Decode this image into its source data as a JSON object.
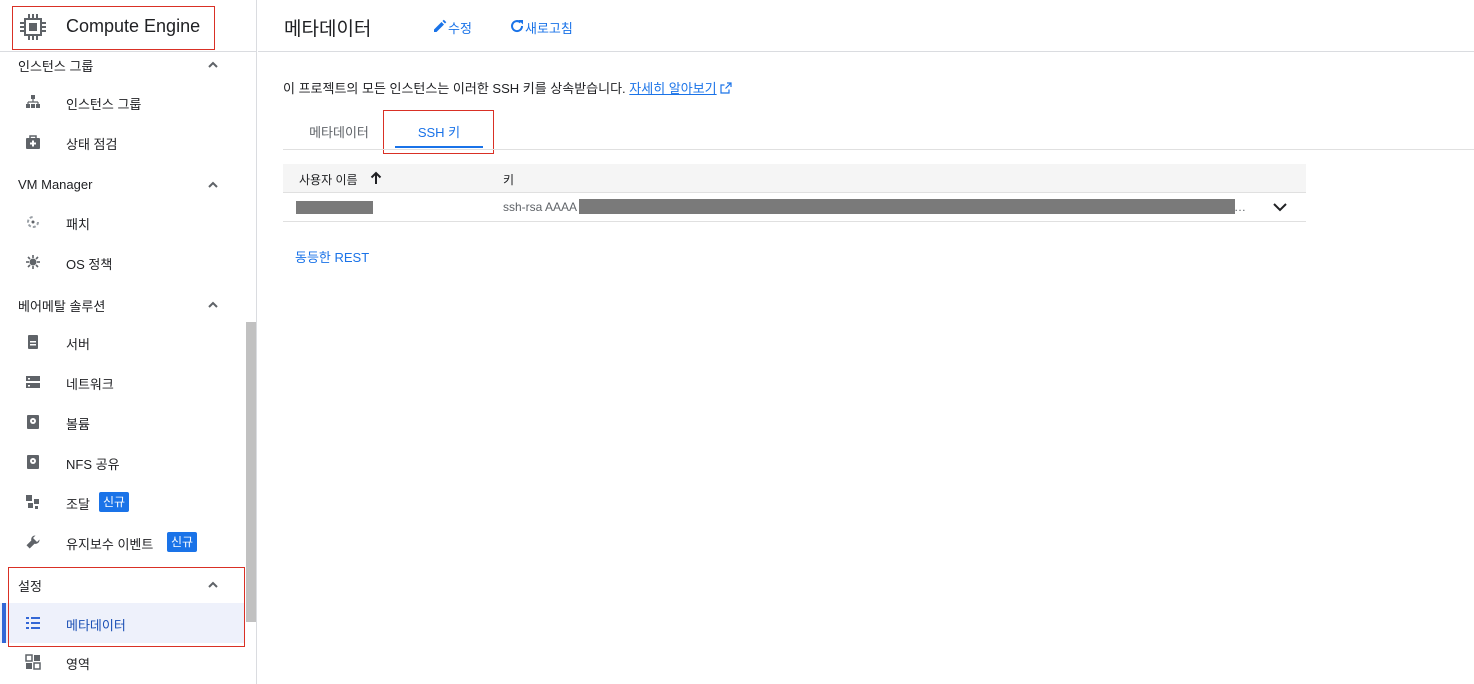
{
  "app": {
    "title": "Compute Engine"
  },
  "sidebar": {
    "sections": [
      {
        "label": "인스턴스 그룹"
      },
      {
        "label": "VM Manager"
      },
      {
        "label": "베어메탈 솔루션"
      },
      {
        "label": "설정"
      }
    ],
    "items": [
      {
        "label": "인스턴스 그룹",
        "icon": "instance-groups-icon"
      },
      {
        "label": "상태 점검",
        "icon": "health-check-icon"
      },
      {
        "label": "패치",
        "icon": "patch-icon"
      },
      {
        "label": "OS 정책",
        "icon": "os-policy-icon"
      },
      {
        "label": "서버",
        "icon": "server-icon"
      },
      {
        "label": "네트워크",
        "icon": "network-icon"
      },
      {
        "label": "볼륨",
        "icon": "volume-icon"
      },
      {
        "label": "NFS 공유",
        "icon": "nfs-share-icon"
      },
      {
        "label": "조달",
        "icon": "procurement-icon",
        "badge": "신규"
      },
      {
        "label": "유지보수 이벤트",
        "icon": "wrench-icon",
        "badge": "신규"
      },
      {
        "label": "메타데이터",
        "icon": "metadata-icon",
        "active": true
      },
      {
        "label": "영역",
        "icon": "zones-icon"
      }
    ]
  },
  "header": {
    "title": "메타데이터",
    "edit_label": "수정",
    "refresh_label": "새로고침"
  },
  "main": {
    "info_text": "이 프로젝트의 모든 인스턴스는 이러한 SSH 키를 상속받습니다.",
    "learn_more": "자세히 알아보기",
    "tabs": [
      {
        "label": "메타데이터"
      },
      {
        "label": "SSH 키",
        "active": true
      }
    ],
    "table": {
      "columns": [
        "사용자 이름",
        "키"
      ],
      "rows": [
        {
          "key_prefix": "ssh-rsa AAAA",
          "ellipsis": "…"
        }
      ]
    },
    "rest_label": "동등한 REST"
  },
  "colors": {
    "accent": "#1a73e8",
    "highlight": "#d93025"
  }
}
